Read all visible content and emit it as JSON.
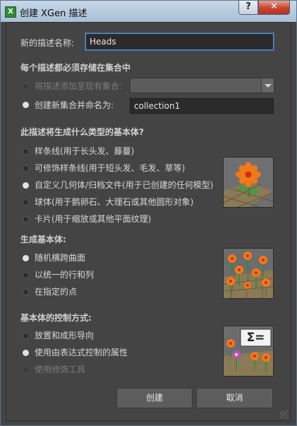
{
  "window": {
    "title": "创建 XGen 描述",
    "app_icon": "X",
    "help_label": "?",
    "close_label": "✕"
  },
  "name_row": {
    "label": "新的描述名称:",
    "value": "Heads"
  },
  "collection": {
    "header": "每个描述都必须存储在集合中",
    "add_existing_label": "将描述添加至现有集合:",
    "create_new_label": "创建新集合并命名为:",
    "new_collection_value": "collection1"
  },
  "primitive_type": {
    "header": "此描述将生成什么类型的基本体?",
    "options": [
      {
        "label": "样条线(用于长头发、藤蔓)",
        "checked": false
      },
      {
        "label": "可修饰样条线(用于短头发、毛发、草等)",
        "checked": false
      },
      {
        "label": "自定义几何体/归档文件(用于已创建的任何模型)",
        "checked": true
      },
      {
        "label": "球体(用于鹅卵石、大理石或其他圆形对象)",
        "checked": false
      },
      {
        "label": "卡片(用于缩放或其他平面纹理)",
        "checked": false
      }
    ]
  },
  "generate": {
    "header": "生成基本体:",
    "options": [
      {
        "label": "随机横跨曲面",
        "checked": true
      },
      {
        "label": "以统一的行和列",
        "checked": false
      },
      {
        "label": "在指定的点",
        "checked": false
      }
    ]
  },
  "control": {
    "header": "基本体的控制方式:",
    "options": [
      {
        "label": "放置和成形导向",
        "checked": false
      },
      {
        "label": "使用由表达式控制的属性",
        "checked": true
      },
      {
        "label": "使用修饰工具",
        "checked": false,
        "disabled": true
      }
    ],
    "badge": "Σ="
  },
  "buttons": {
    "create": "创建",
    "cancel": "取消"
  },
  "colors": {
    "accent": "#5b93c7",
    "background": "#444444",
    "close": "#c6432b"
  }
}
